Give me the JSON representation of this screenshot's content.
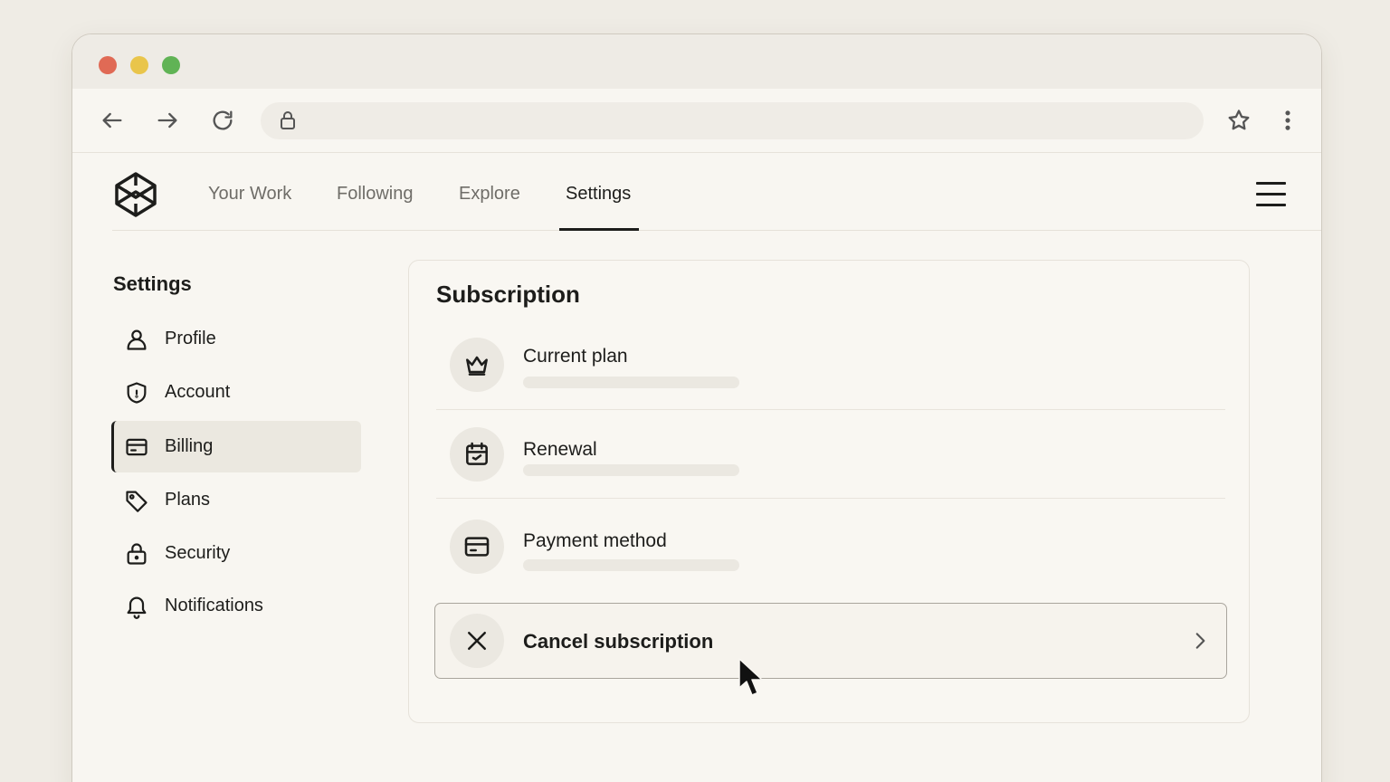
{
  "nav": {
    "tabs": [
      {
        "label": "Your Work"
      },
      {
        "label": "Following"
      },
      {
        "label": "Explore"
      },
      {
        "label": "Settings",
        "active": true
      }
    ]
  },
  "sidebar": {
    "title": "Settings",
    "items": [
      {
        "label": "Profile",
        "icon": "user-icon"
      },
      {
        "label": "Account",
        "icon": "shield-icon"
      },
      {
        "label": "Billing",
        "icon": "credit-card-icon",
        "active": true
      },
      {
        "label": "Plans",
        "icon": "tag-icon"
      },
      {
        "label": "Security",
        "icon": "lock-icon"
      },
      {
        "label": "Notifications",
        "icon": "bell-icon"
      }
    ]
  },
  "subscription": {
    "title": "Subscription",
    "rows": [
      {
        "label": "Current plan",
        "icon": "crown-icon"
      },
      {
        "label": "Renewal",
        "icon": "calendar-icon"
      },
      {
        "label": "Payment method",
        "icon": "credit-card-icon"
      }
    ],
    "cancel": {
      "label": "Cancel subscription",
      "icon": "close-icon"
    }
  },
  "colors": {
    "background": "#efece5",
    "window": "#f8f6f1",
    "text": "#1d1d1b",
    "muted_text": "#6f6d68",
    "traffic_red": "#e06a55",
    "traffic_yellow": "#e9c54b",
    "traffic_green": "#60b355"
  }
}
